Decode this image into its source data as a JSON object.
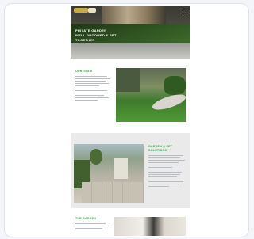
{
  "hero": {
    "title": "PRIVATE GARDEN\nWELL GROOMED & SET\nTOGETHER"
  },
  "sections": [
    {
      "title": "OUR TEAM"
    },
    {
      "title": "GARDEN & SET\nSOLUTIONS"
    },
    {
      "title": "THE GARDEN"
    }
  ],
  "icons": {
    "menu": "hamburger-menu-icon",
    "logo": "company-logo"
  }
}
